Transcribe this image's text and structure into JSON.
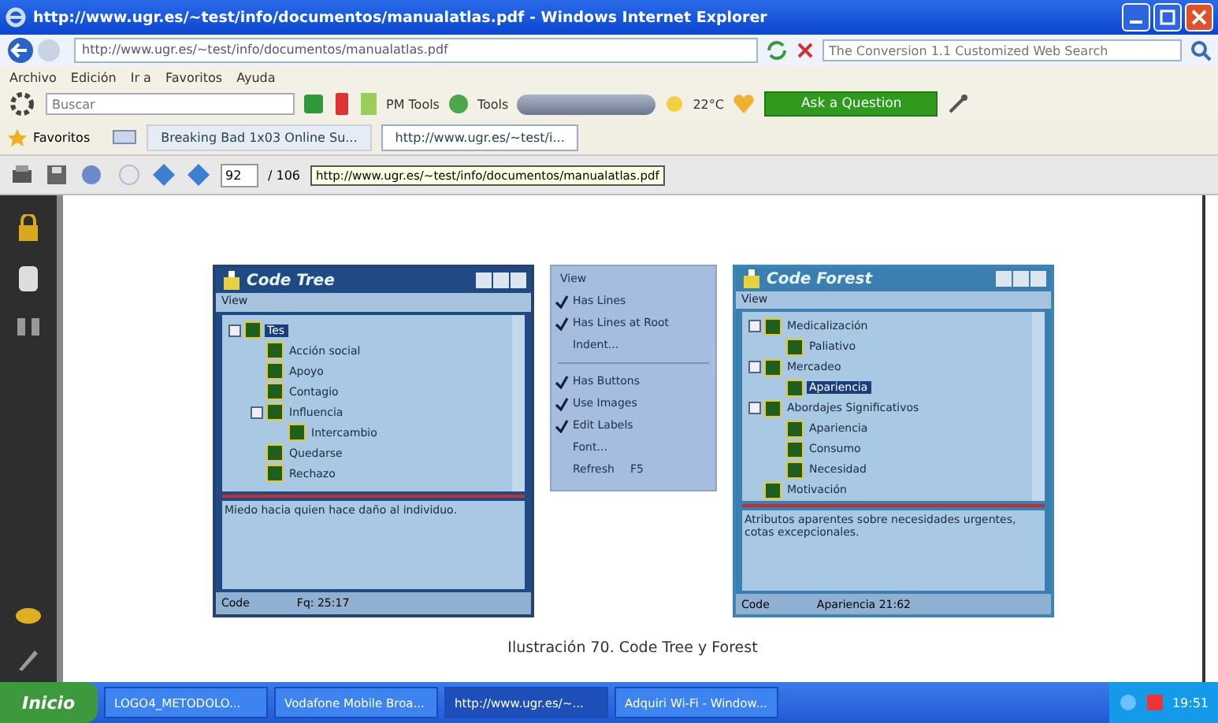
{
  "window": {
    "title": "http://www.ugr.es/~test/info/documentos/manualatlas.pdf - Windows Internet Explorer"
  },
  "address_bar": {
    "value": "http://www.ugr.es/~test/info/documentos/manualatlas.pdf",
    "search_placeholder": "The Conversion 1.1 Customized Web Search"
  },
  "menu_bar": [
    "Archivo",
    "Edición",
    "Ir a",
    "Favoritos",
    "Ayuda"
  ],
  "toolbar": {
    "search_placeholder": "Buscar",
    "pm_tools": "PM Tools",
    "tools": "Tools",
    "weather": "22°C",
    "ask_button": "Ask a Question"
  },
  "favorites_bar": {
    "label": "Favoritos",
    "tabs": [
      {
        "label": "Breaking Bad 1x03 Online Su...",
        "selected": false
      },
      {
        "label": "http://www.ugr.es/~test/i...",
        "selected": true
      }
    ]
  },
  "pdf_toolbar": {
    "page": "92",
    "page_count": "/ 106",
    "url": "http://www.ugr.es/~test/info/documentos/manualatlas.pdf"
  },
  "code_tree": {
    "title": "Code Tree",
    "menu": "View",
    "nodes": [
      {
        "label": "Tes",
        "selected": true,
        "children": [
          {
            "label": "Acción social",
            "selected": false
          },
          {
            "label": "Apoyo",
            "selected": false
          },
          {
            "label": "Contagio",
            "selected": false
          },
          {
            "label": "Influencia",
            "selected": false,
            "children": [
              {
                "label": "Intercambio",
                "selected": false
              }
            ]
          },
          {
            "label": "Quedarse",
            "selected": false
          },
          {
            "label": "Rechazo",
            "selected": false
          }
        ]
      }
    ],
    "memo": "Miedo hacia quien hace daño al individuo.",
    "status_label": "Code",
    "status_value": "Fq: 25:17"
  },
  "view_menu": {
    "title": "View",
    "items": [
      {
        "kind": "item",
        "label": "Has Lines",
        "checked": true
      },
      {
        "kind": "item",
        "label": "Has Lines at Root",
        "checked": true
      },
      {
        "kind": "item",
        "label": "Indent...",
        "checked": false
      },
      {
        "kind": "separator"
      },
      {
        "kind": "item",
        "label": "Has Buttons",
        "checked": true
      },
      {
        "kind": "item",
        "label": "Use Images",
        "checked": true
      },
      {
        "kind": "item",
        "label": "Edit Labels",
        "checked": true
      },
      {
        "kind": "item",
        "label": "Font...",
        "checked": false
      },
      {
        "kind": "item",
        "label": "Refresh",
        "shortcut": "F5",
        "checked": false
      }
    ]
  },
  "code_forest": {
    "title": "Code Forest",
    "menu": "View",
    "nodes": [
      {
        "label": "Medicalización",
        "selected": false,
        "children": [
          {
            "label": "Paliativo",
            "selected": false
          }
        ]
      },
      {
        "label": "Mercadeo",
        "selected": false,
        "children": [
          {
            "label": "Apariencia",
            "selected": true
          }
        ]
      },
      {
        "label": "Abordajes Significativos",
        "selected": false,
        "children": [
          {
            "label": "Apariencia",
            "selected": false
          },
          {
            "label": "Consumo",
            "selected": false
          },
          {
            "label": "Necesidad",
            "selected": false
          }
        ]
      },
      {
        "label": "Motivación",
        "selected": false
      }
    ],
    "memo": "Atributos aparentes sobre necesidades urgentes, cotas excepcionales.",
    "status_label": "Code",
    "status_value": "Apariencia 21:62"
  },
  "caption": "Ilustración 70. Code Tree y Forest",
  "taskbar": {
    "start": "Inicio",
    "tasks": [
      {
        "label": "LOGO4_METODOLO...",
        "selected": false
      },
      {
        "label": "Vodafone Mobile Broa...",
        "selected": false
      },
      {
        "label": "http://www.ugr.es/~...",
        "selected": true
      },
      {
        "label": "Adquiri Wi-Fi - Window...",
        "selected": false
      }
    ],
    "clock": "19:51"
  }
}
